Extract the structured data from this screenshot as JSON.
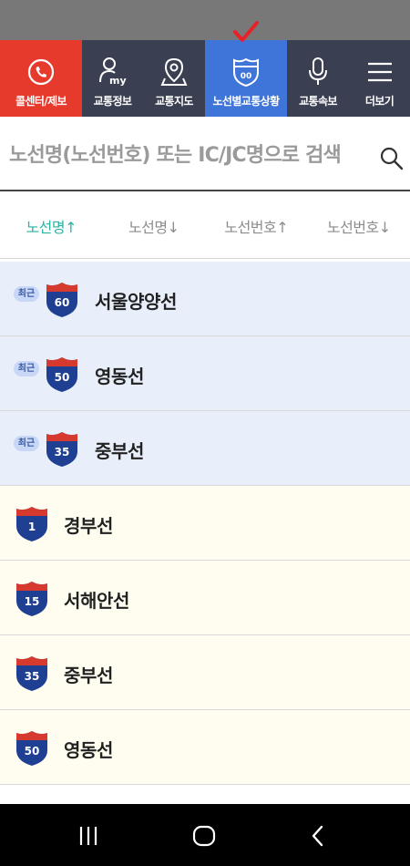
{
  "nav": {
    "call_label": "콜센터/제보",
    "info_label": "교통정보",
    "info_icon_text": "my",
    "map_label": "교통지도",
    "route_label": "노선별교통상황",
    "route_icon_text": "00",
    "news_label": "교통속보",
    "more_label": "더보기"
  },
  "search": {
    "placeholder": "노선명(노선번호) 또는 IC/JC명으로 검색"
  },
  "sort_tabs": [
    {
      "label": "노선명↑",
      "active": true
    },
    {
      "label": "노선명↓",
      "active": false
    },
    {
      "label": "노선번호↑",
      "active": false
    },
    {
      "label": "노선번호↓",
      "active": false
    }
  ],
  "recent_badge": "최근",
  "routes": [
    {
      "number": "60",
      "name": "서울양양선",
      "recent": true
    },
    {
      "number": "50",
      "name": "영동선",
      "recent": true
    },
    {
      "number": "35",
      "name": "중부선",
      "recent": true
    },
    {
      "number": "1",
      "name": "경부선",
      "recent": false
    },
    {
      "number": "15",
      "name": "서해안선",
      "recent": false
    },
    {
      "number": "35",
      "name": "중부선",
      "recent": false
    },
    {
      "number": "50",
      "name": "영동선",
      "recent": false
    }
  ],
  "colors": {
    "call_bg": "#e63a2c",
    "nav_bg": "#3a3f52",
    "active_nav_bg": "#3f74d9",
    "active_sort": "#2bb3a3",
    "recent_row_bg": "#e8eefa",
    "plain_row_bg": "#fefdf0",
    "shield_blue": "#1f3f93",
    "shield_red": "#d63a2f",
    "check_red": "#e8202a"
  },
  "icons": {
    "call": "phone-icon",
    "info": "person-my-icon",
    "map": "location-pin-icon",
    "route": "highway-shield-icon",
    "news": "microphone-icon",
    "more": "hamburger-menu-icon",
    "search": "search-icon",
    "check": "check-mark-icon",
    "sys_recent": "recent-apps-icon",
    "sys_home": "home-icon",
    "sys_back": "back-icon"
  }
}
